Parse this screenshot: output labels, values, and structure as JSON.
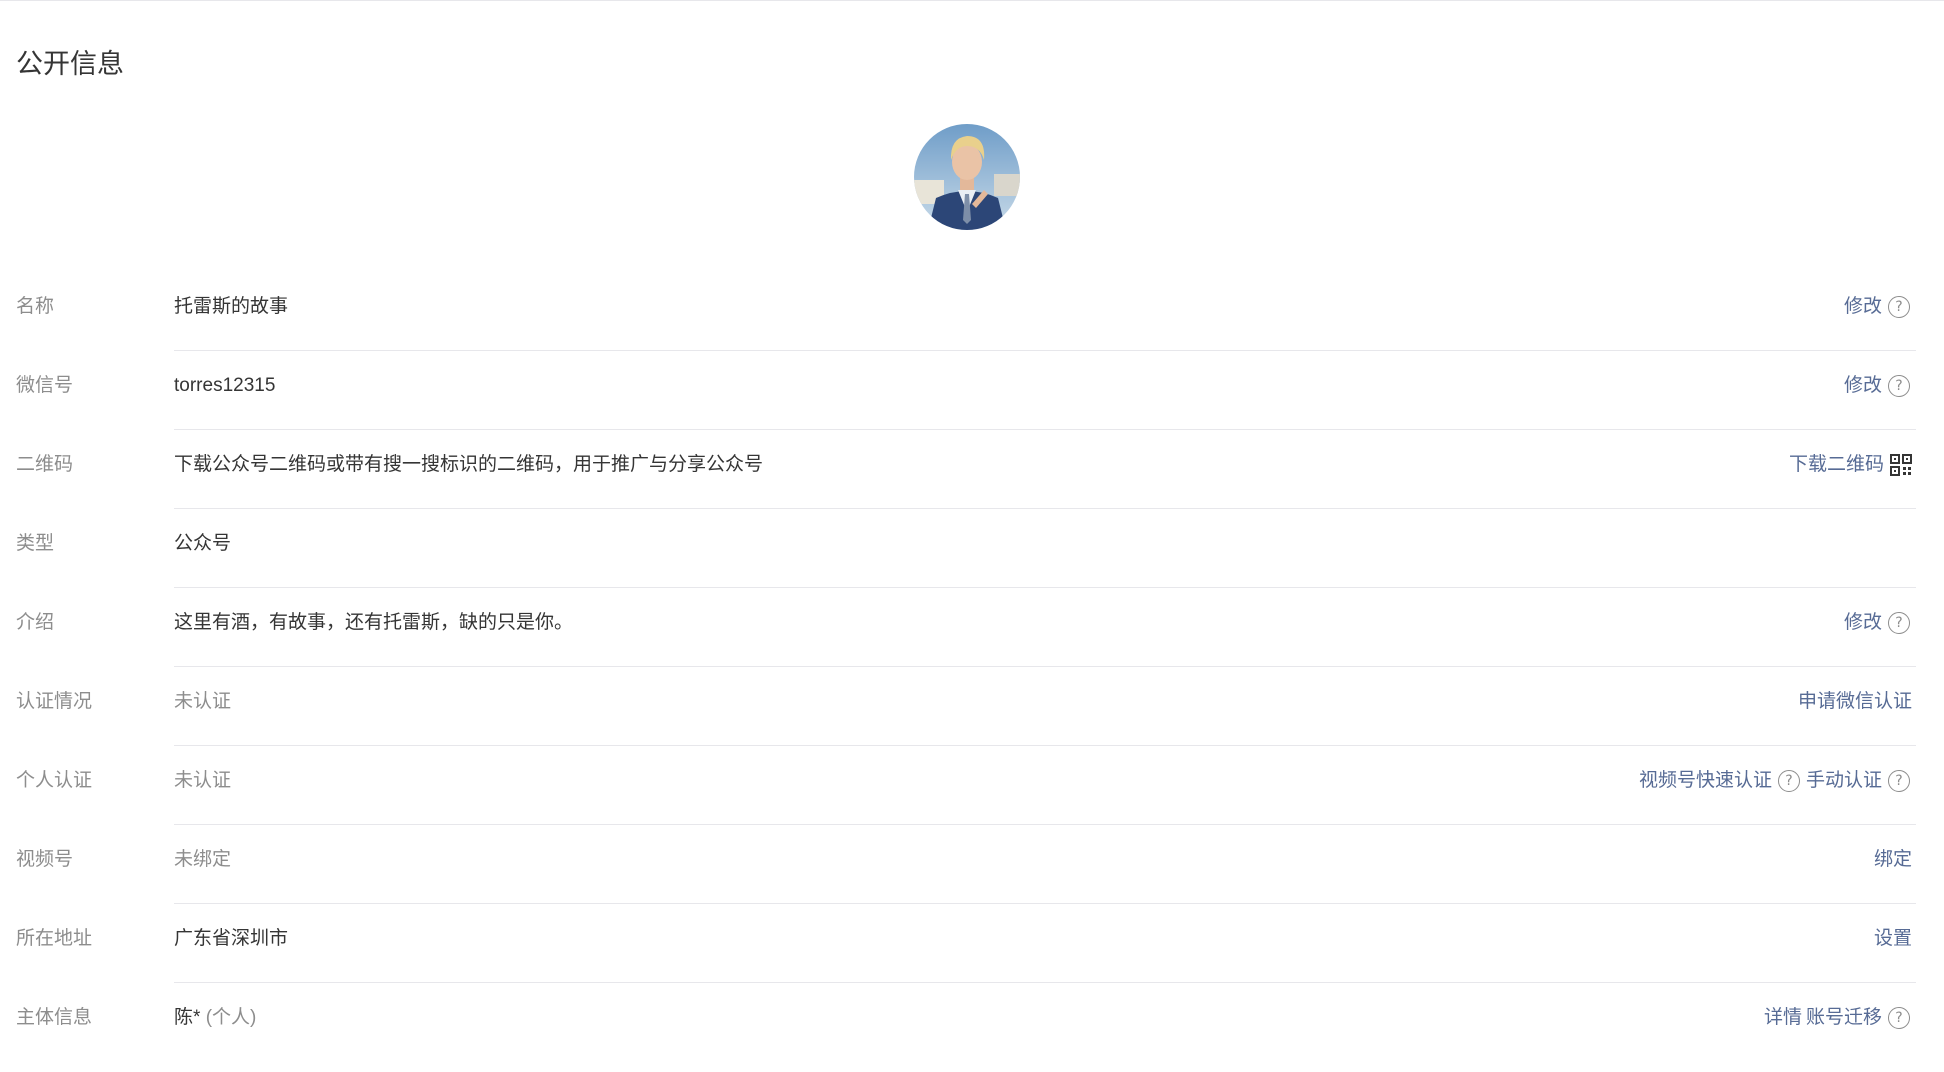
{
  "section_title": "公开信息",
  "rows": [
    {
      "label": "名称",
      "value": "托雷斯的故事",
      "actions": [
        "修改"
      ]
    },
    {
      "label": "微信号",
      "value": "torres12315",
      "actions": [
        "修改"
      ]
    },
    {
      "label": "二维码",
      "value": "下载公众号二维码或带有搜一搜标识的二维码，用于推广与分享公众号",
      "actions": [
        "下载二维码"
      ]
    },
    {
      "label": "类型",
      "value": "公众号"
    },
    {
      "label": "介绍",
      "value": "这里有酒，有故事，还有托雷斯，缺的只是你。",
      "actions": [
        "修改"
      ]
    },
    {
      "label": "认证情况",
      "value": "未认证",
      "actions": [
        "申请微信认证"
      ]
    },
    {
      "label": "个人认证",
      "value": "未认证",
      "actions": [
        "视频号快速认证",
        "手动认证"
      ]
    },
    {
      "label": "视频号",
      "value": "未绑定",
      "actions": [
        "绑定"
      ]
    },
    {
      "label": "所在地址",
      "value": "广东省深圳市",
      "actions": [
        "设置"
      ]
    },
    {
      "label": "主体信息",
      "value": "陈*",
      "value_sub": "(个人)",
      "actions": [
        "详情",
        "账号迁移"
      ]
    }
  ],
  "icons": {
    "help": "question-circle-icon",
    "qr": "qr-code-icon"
  },
  "help_glyph": "?",
  "colors": {
    "link": "#576b95",
    "label": "#8d8d8d",
    "text": "#353535",
    "divider": "#e7e7eb"
  }
}
